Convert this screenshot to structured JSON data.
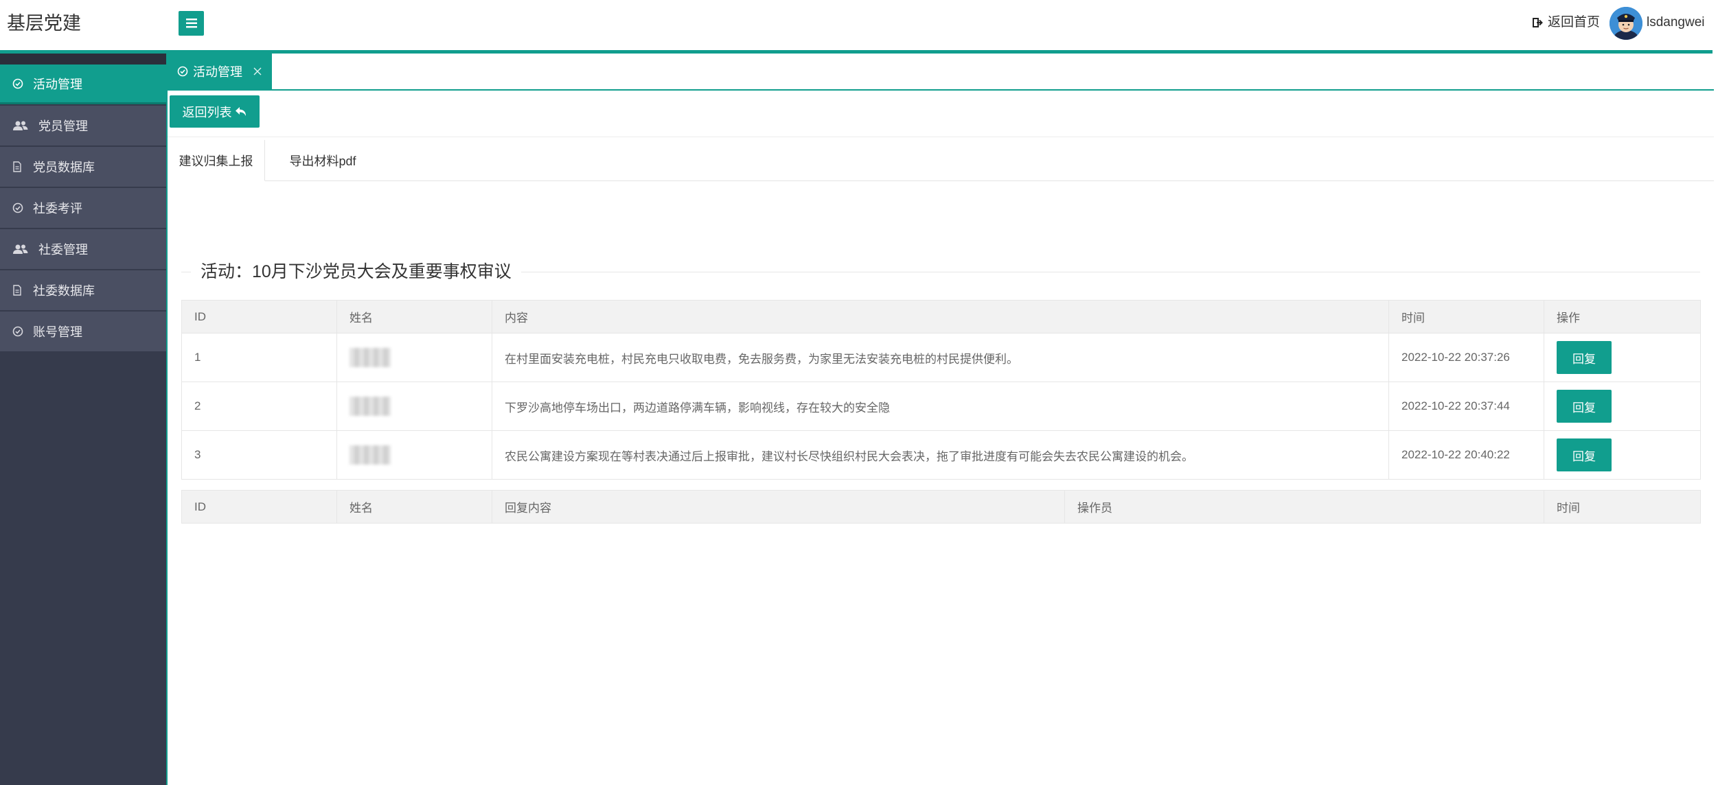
{
  "app": {
    "title": "基层党建"
  },
  "header": {
    "home_label": "返回首页",
    "username": "lsdangwei"
  },
  "sidebar": {
    "items": [
      {
        "label": "活动管理",
        "icon": "check-circle-icon",
        "active": true
      },
      {
        "label": "党员管理",
        "icon": "users-icon"
      },
      {
        "label": "党员数据库",
        "icon": "file-icon"
      },
      {
        "label": "社委考评",
        "icon": "check-circle-icon"
      },
      {
        "label": "社委管理",
        "icon": "users-icon"
      },
      {
        "label": "社委数据库",
        "icon": "file-icon"
      },
      {
        "label": "账号管理",
        "icon": "check-circle-icon"
      }
    ]
  },
  "tab": {
    "label": "活动管理"
  },
  "toolbar": {
    "back_label": "返回列表"
  },
  "subtabs": {
    "report": "建议归集上报",
    "export": "导出材料pdf"
  },
  "section": {
    "title": "活动：10月下沙党员大会及重要事权审议"
  },
  "suggestions": {
    "headers": {
      "id": "ID",
      "name": "姓名",
      "content": "内容",
      "time": "时间",
      "action": "操作"
    },
    "rows": [
      {
        "id": "1",
        "content": "在村里面安装充电桩，村民充电只收取电费，免去服务费，为家里无法安装充电桩的村民提供便利。",
        "time": "2022-10-22 20:37:26",
        "action": "回复"
      },
      {
        "id": "2",
        "content": "下罗沙高地停车场出口，两边道路停满车辆，影响视线，存在较大的安全隐",
        "time": "2022-10-22 20:37:44",
        "action": "回复"
      },
      {
        "id": "3",
        "content": "农民公寓建设方案现在等村表决通过后上报审批，建议村长尽快组织村民大会表决，拖了审批进度有可能会失去农民公寓建设的机会。",
        "time": "2022-10-22 20:40:22",
        "action": "回复"
      }
    ]
  },
  "replies": {
    "headers": {
      "id": "ID",
      "name": "姓名",
      "content": "回复内容",
      "operator": "操作员",
      "time": "时间"
    }
  },
  "colors": {
    "accent": "#119e8e",
    "sidebar_bg": "#363b4c",
    "sidebar_item": "#4a4f62"
  }
}
